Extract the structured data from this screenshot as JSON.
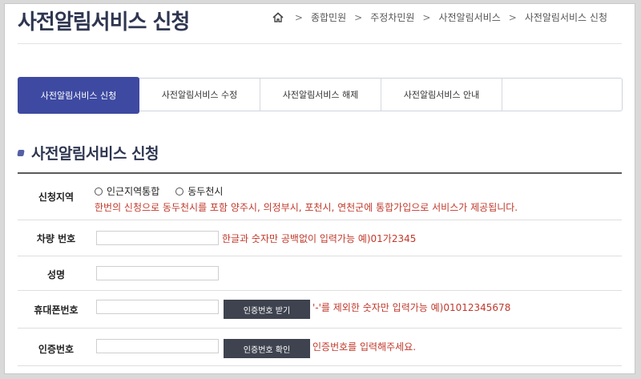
{
  "page_title": "사전알림서비스 신청",
  "breadcrumb": {
    "items": [
      "종합민원",
      "주정차민원",
      "사전알림서비스",
      "사전알림서비스 신청"
    ],
    "separator": ">"
  },
  "tabs": [
    {
      "label": "사전알림서비스 신청",
      "active": true
    },
    {
      "label": "사전알림서비스 수정",
      "active": false
    },
    {
      "label": "사전알림서비스 해제",
      "active": false
    },
    {
      "label": "사전알림서비스 안내",
      "active": false
    }
  ],
  "section_title": "사전알림서비스 신청",
  "form": {
    "region": {
      "label": "신청지역",
      "options": [
        "인근지역통합",
        "동두천시"
      ],
      "note": "한번의 신청으로 동두천시를 포함 양주시, 의정부시, 포천시, 연천군에 통합가입으로 서비스가 제공됩니다."
    },
    "car_number": {
      "label": "차량 번호",
      "value": "",
      "note": "한글과 숫자만 공백없이 입력가능 예)01가2345"
    },
    "name": {
      "label": "성명",
      "value": ""
    },
    "phone": {
      "label": "휴대폰번호",
      "value": "",
      "button": "인증번호 받기",
      "note": "'-'를 제외한 숫자만 입력가능 예)01012345678"
    },
    "auth_code": {
      "label": "인증번호",
      "value": "",
      "button": "인증번호 확인",
      "note": "인증번호를 입력해주세요."
    }
  },
  "colors": {
    "accent": "#3e4aa1",
    "title": "#2e3650",
    "note": "#c0392b",
    "button": "#3e434f"
  }
}
